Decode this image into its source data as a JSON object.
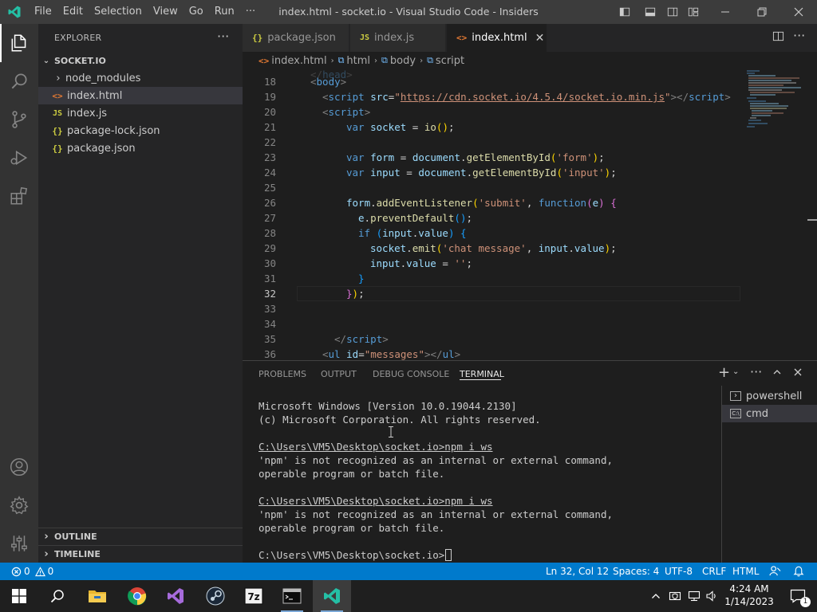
{
  "window": {
    "title": "index.html - socket.io - Visual Studio Code - Insiders",
    "menu": [
      "File",
      "Edit",
      "Selection",
      "View",
      "Go",
      "Run",
      "···"
    ]
  },
  "sidebar": {
    "title": "EXPLORER",
    "more": "···",
    "folder": "SOCKET.IO",
    "items": [
      {
        "label": "node_modules",
        "icon": "›",
        "kind": "folder"
      },
      {
        "label": "index.html",
        "icon": "<>",
        "kind": "html"
      },
      {
        "label": "index.js",
        "icon": "JS",
        "kind": "js"
      },
      {
        "label": "package-lock.json",
        "icon": "{}",
        "kind": "json"
      },
      {
        "label": "package.json",
        "icon": "{}",
        "kind": "json"
      }
    ],
    "outline": "OUTLINE",
    "timeline": "TIMELINE"
  },
  "tabs": [
    {
      "label": "package.json",
      "icon": "{}"
    },
    {
      "label": "index.js",
      "icon": "JS"
    },
    {
      "label": "index.html",
      "icon": "<>",
      "close": "✕"
    }
  ],
  "breadcrumb": [
    "index.html",
    "html",
    "body",
    "script"
  ],
  "code": {
    "line_numbers": [
      "18",
      "19",
      "20",
      "21",
      "22",
      "23",
      "24",
      "25",
      "26",
      "27",
      "28",
      "29",
      "30",
      "31",
      "32",
      "33",
      "34",
      "35",
      "36"
    ],
    "current_line": "32"
  },
  "panel": {
    "tabs": [
      "PROBLEMS",
      "OUTPUT",
      "DEBUG CONSOLE",
      "TERMINAL"
    ],
    "terminal_lines": [
      "Microsoft Windows [Version 10.0.19044.2130]",
      "(c) Microsoft Corporation. All rights reserved.",
      "",
      "C:\\Users\\VM5\\Desktop\\socket.io>npm i ws",
      "'npm' is not recognized as an internal or external command,",
      "operable program or batch file.",
      "",
      "C:\\Users\\VM5\\Desktop\\socket.io>npm i ws",
      "'npm' is not recognized as an internal or external command,",
      "operable program or batch file.",
      "",
      "C:\\Users\\VM5\\Desktop\\socket.io>"
    ],
    "terminals": [
      "powershell",
      "cmd"
    ]
  },
  "statusbar": {
    "errors": "0",
    "warnings": "0",
    "position": "Ln 32, Col 12",
    "spaces": "Spaces: 4",
    "encoding": "UTF-8",
    "eol": "CRLF",
    "language": "HTML"
  },
  "taskbar": {
    "time": "4:24 AM",
    "date": "1/14/2023",
    "notifications": "1"
  },
  "colors": {
    "accent": "#007acc",
    "titlebar": "#3c3c3c",
    "activitybar": "#333333",
    "sidebar": "#252526",
    "editor": "#1e1e1e"
  }
}
